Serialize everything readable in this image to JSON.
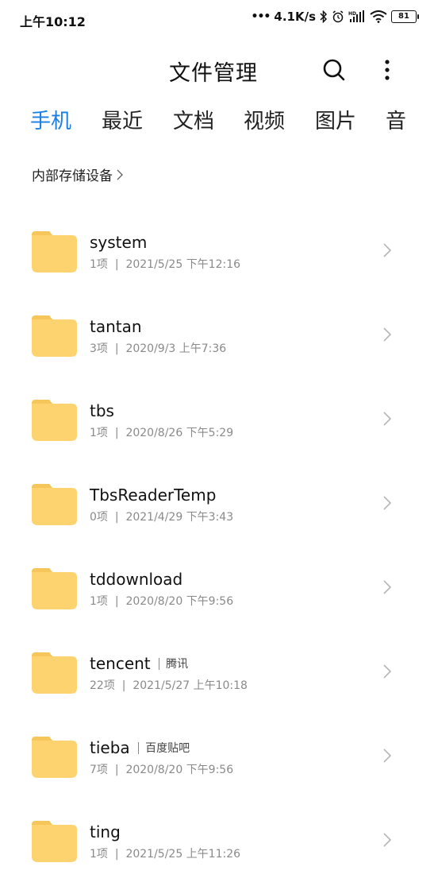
{
  "status_bar": {
    "time": "上午10:12",
    "net_speed": "4.1K/s",
    "battery": "81",
    "hd_label": "HD"
  },
  "header": {
    "title": "文件管理"
  },
  "tabs": [
    {
      "label": "手机",
      "active": true
    },
    {
      "label": "最近",
      "active": false
    },
    {
      "label": "文档",
      "active": false
    },
    {
      "label": "视频",
      "active": false
    },
    {
      "label": "图片",
      "active": false
    },
    {
      "label": "音",
      "active": false
    }
  ],
  "breadcrumb": {
    "label": "内部存储设备"
  },
  "folders": [
    {
      "name": "system",
      "alias": "",
      "count": "1项",
      "date": "2021/5/25 下午12:16"
    },
    {
      "name": "tantan",
      "alias": "",
      "count": "3项",
      "date": "2020/9/3 上午7:36"
    },
    {
      "name": "tbs",
      "alias": "",
      "count": "1项",
      "date": "2020/8/26 下午5:29"
    },
    {
      "name": "TbsReaderTemp",
      "alias": "",
      "count": "0项",
      "date": "2021/4/29 下午3:43"
    },
    {
      "name": "tddownload",
      "alias": "",
      "count": "1项",
      "date": "2020/8/20 下午9:56"
    },
    {
      "name": "tencent",
      "alias": "腾讯",
      "count": "22项",
      "date": "2021/5/27 上午10:18"
    },
    {
      "name": "tieba",
      "alias": "百度贴吧",
      "count": "7项",
      "date": "2020/8/20 下午9:56"
    },
    {
      "name": "ting",
      "alias": "",
      "count": "1项",
      "date": "2021/5/25 上午11:26"
    }
  ],
  "colors": {
    "accent": "#1a7fe3",
    "folder": "#fdd36f",
    "folder_tab": "#f7c65a"
  }
}
